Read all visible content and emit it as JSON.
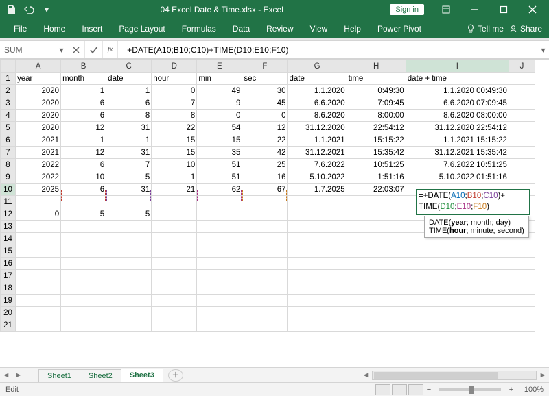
{
  "window": {
    "title": "04 Excel Date & Time.xlsx  -  Excel",
    "signin": "Sign in"
  },
  "ribbon": {
    "tabs": [
      "File",
      "Home",
      "Insert",
      "Page Layout",
      "Formulas",
      "Data",
      "Review",
      "View",
      "Help",
      "Power Pivot"
    ],
    "tell_me": "Tell me",
    "share": "Share"
  },
  "formula_bar": {
    "name_box": "SUM",
    "formula": "=+DATE(A10;B10;C10)+TIME(D10;E10;F10)"
  },
  "grid": {
    "columns": [
      "A",
      "B",
      "C",
      "D",
      "E",
      "F",
      "G",
      "H",
      "I",
      "J"
    ],
    "headers": {
      "A": "year",
      "B": "month",
      "C": "date",
      "D": "hour",
      "E": "min",
      "F": "sec",
      "G": "date",
      "H": "time",
      "I": "date + time"
    },
    "rows": [
      {
        "n": 2,
        "A": 2020,
        "B": 1,
        "C": 1,
        "D": 0,
        "E": 49,
        "F": 30,
        "G": "1.1.2020",
        "H": "0:49:30",
        "I": "1.1.2020 00:49:30"
      },
      {
        "n": 3,
        "A": 2020,
        "B": 6,
        "C": 6,
        "D": 7,
        "E": 9,
        "F": 45,
        "G": "6.6.2020",
        "H": "7:09:45",
        "I": "6.6.2020 07:09:45"
      },
      {
        "n": 4,
        "A": 2020,
        "B": 6,
        "C": 8,
        "D": 8,
        "E": 0,
        "F": 0,
        "G": "8.6.2020",
        "H": "8:00:00",
        "I": "8.6.2020 08:00:00"
      },
      {
        "n": 5,
        "A": 2020,
        "B": 12,
        "C": 31,
        "D": 22,
        "E": 54,
        "F": 12,
        "G": "31.12.2020",
        "H": "22:54:12",
        "I": "31.12.2020 22:54:12"
      },
      {
        "n": 6,
        "A": 2021,
        "B": 1,
        "C": 1,
        "D": 15,
        "E": 15,
        "F": 22,
        "G": "1.1.2021",
        "H": "15:15:22",
        "I": "1.1.2021 15:15:22"
      },
      {
        "n": 7,
        "A": 2021,
        "B": 12,
        "C": 31,
        "D": 15,
        "E": 35,
        "F": 42,
        "G": "31.12.2021",
        "H": "15:35:42",
        "I": "31.12.2021 15:35:42"
      },
      {
        "n": 8,
        "A": 2022,
        "B": 6,
        "C": 7,
        "D": 10,
        "E": 51,
        "F": 25,
        "G": "7.6.2022",
        "H": "10:51:25",
        "I": "7.6.2022 10:51:25"
      },
      {
        "n": 9,
        "A": 2022,
        "B": 10,
        "C": 5,
        "D": 1,
        "E": 51,
        "F": 16,
        "G": "5.10.2022",
        "H": "1:51:16",
        "I": "5.10.2022 01:51:16"
      },
      {
        "n": 10,
        "A": 2025,
        "B": 6,
        "C": 31,
        "D": 21,
        "E": 62,
        "F": 67,
        "G": "1.7.2025",
        "H": "22:03:07",
        "I": ""
      },
      {
        "n": 11,
        "A": "",
        "B": "",
        "C": "",
        "D": "",
        "E": "",
        "F": "",
        "G": "",
        "H": "",
        "I": ""
      },
      {
        "n": 12,
        "A": 0,
        "B": 5,
        "C": 5,
        "D": "",
        "E": "",
        "F": "",
        "G": "",
        "H": "",
        "I": ""
      },
      {
        "n": 13
      },
      {
        "n": 14
      },
      {
        "n": 15
      },
      {
        "n": 16
      },
      {
        "n": 17
      },
      {
        "n": 18
      },
      {
        "n": 19
      },
      {
        "n": 20
      },
      {
        "n": 21
      }
    ]
  },
  "editing": {
    "parts": {
      "pre1": "=+DATE(",
      "a": "A10",
      "sep": ";",
      "b": "B10",
      "c": "C10",
      "mid": ")+",
      "pre2": "TIME(",
      "d": "D10",
      "e": "E10",
      "f": "F10",
      "end": ")"
    }
  },
  "tooltip": {
    "line1_fn": "DATE",
    "line1_args": "(",
    "line1_b": "year",
    "line1_rest": "; month; day)",
    "line2_fn": "TIME",
    "line2_args": "(",
    "line2_b": "hour",
    "line2_rest": "; minute; second)"
  },
  "sheets": {
    "tabs": [
      "Sheet1",
      "Sheet2",
      "Sheet3"
    ],
    "active": 2
  },
  "status": {
    "mode": "Edit",
    "zoom": "100%"
  }
}
